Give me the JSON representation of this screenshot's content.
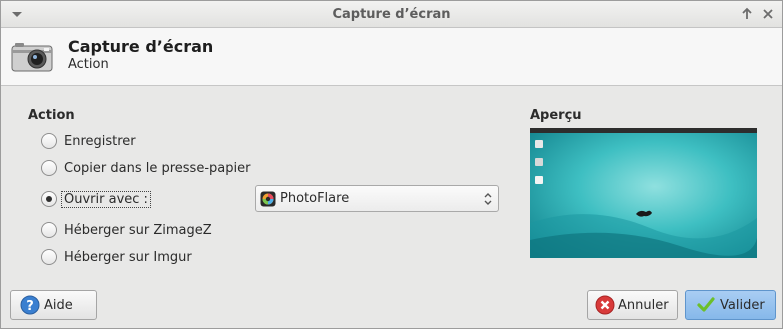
{
  "window": {
    "title": "Capture d’écran"
  },
  "header": {
    "title": "Capture d’écran",
    "subtitle": "Action",
    "icon": "camera-icon"
  },
  "action_section": {
    "title": "Action",
    "options": [
      {
        "label": "Enregistrer",
        "selected": false
      },
      {
        "label": "Copier dans le presse-papier",
        "selected": false
      },
      {
        "label": "Ouvrir avec :",
        "selected": true
      },
      {
        "label": "Héberger sur ZimageZ",
        "selected": false
      },
      {
        "label": "Héberger sur Imgur",
        "selected": false
      }
    ],
    "open_with_app": "PhotoFlare"
  },
  "preview_section": {
    "title": "Aperçu"
  },
  "buttons": {
    "help": "Aide",
    "cancel": "Annuler",
    "validate": "Valider"
  },
  "colors": {
    "primary_button": "#8dbdec",
    "cancel_icon": "#d83a3a",
    "validate_icon": "#6cbf2a",
    "help_icon": "#3a7fd0"
  }
}
